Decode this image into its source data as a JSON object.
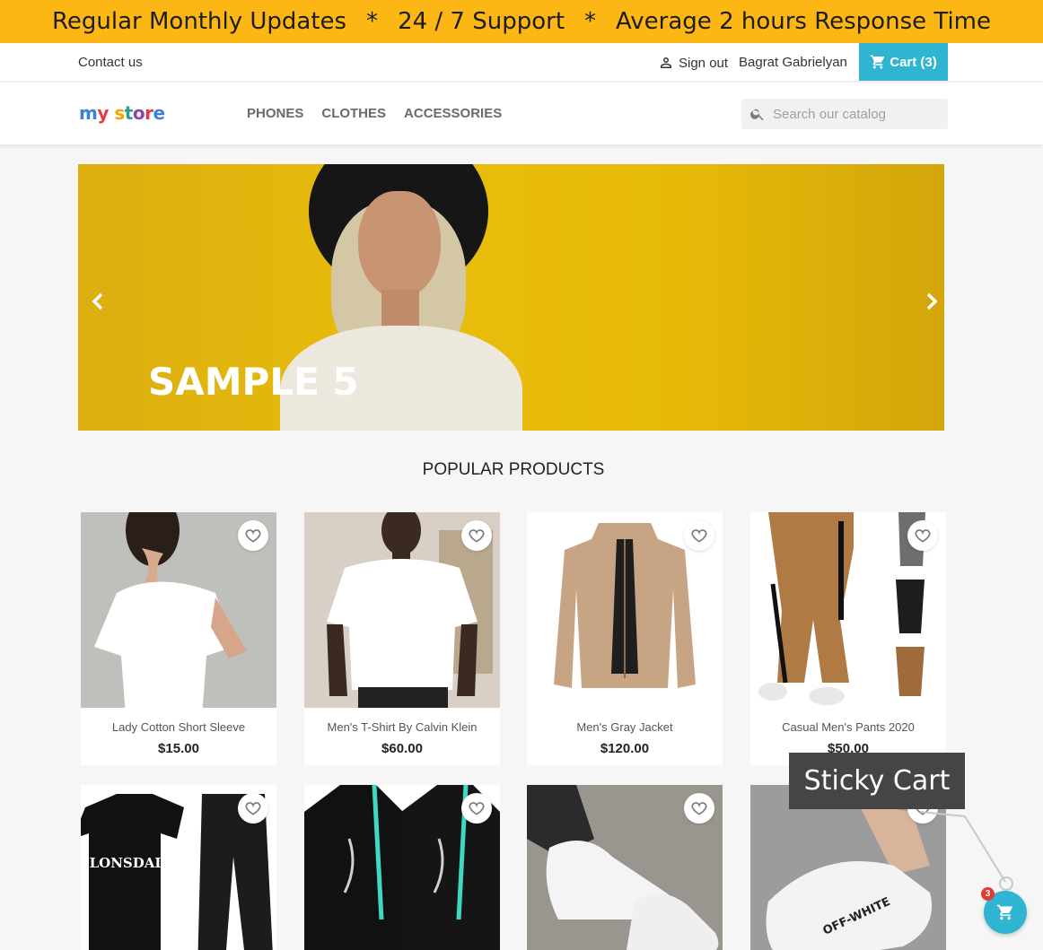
{
  "promo": {
    "part1": "Regular Monthly Updates",
    "sep1": "*",
    "part2": "24 / 7 Support",
    "sep2": "*",
    "part3": "Average 2 hours Response Time"
  },
  "top_nav": {
    "contact": "Contact us",
    "sign_out": "Sign out",
    "user_name": "Bagrat Gabrielyan",
    "cart_label": "Cart (3)"
  },
  "header": {
    "logo_letters": [
      "m",
      "y",
      " ",
      "s",
      "t",
      "o",
      "r",
      "e"
    ],
    "logo_text": "my store",
    "menu": [
      "PHONES",
      "CLOTHES",
      "ACCESSORIES"
    ],
    "search_placeholder": "Search our catalog"
  },
  "slider": {
    "caption": "SAMPLE 5"
  },
  "section": {
    "title": "POPULAR PRODUCTS"
  },
  "products": [
    {
      "name": "Lady Cotton Short Sleeve",
      "price": "$15.00"
    },
    {
      "name": "Men's T-Shirt By Calvin Klein",
      "price": "$60.00"
    },
    {
      "name": "Men's Gray Jacket",
      "price": "$120.00"
    },
    {
      "name": "Casual Men's Pants 2020",
      "price": "$50.00"
    },
    {
      "name": "",
      "price": ""
    },
    {
      "name": "",
      "price": ""
    },
    {
      "name": "",
      "price": ""
    },
    {
      "name": "",
      "price": ""
    }
  ],
  "product_images": {
    "lonsdale_text": "LONSDALE",
    "offwhite_text": "OFF-WHITE"
  },
  "sticky": {
    "label": "Sticky Cart",
    "badge": "3"
  },
  "colors": {
    "promo_bg": "#fdb714",
    "accent": "#2fb5d2",
    "badge": "#e53935"
  }
}
